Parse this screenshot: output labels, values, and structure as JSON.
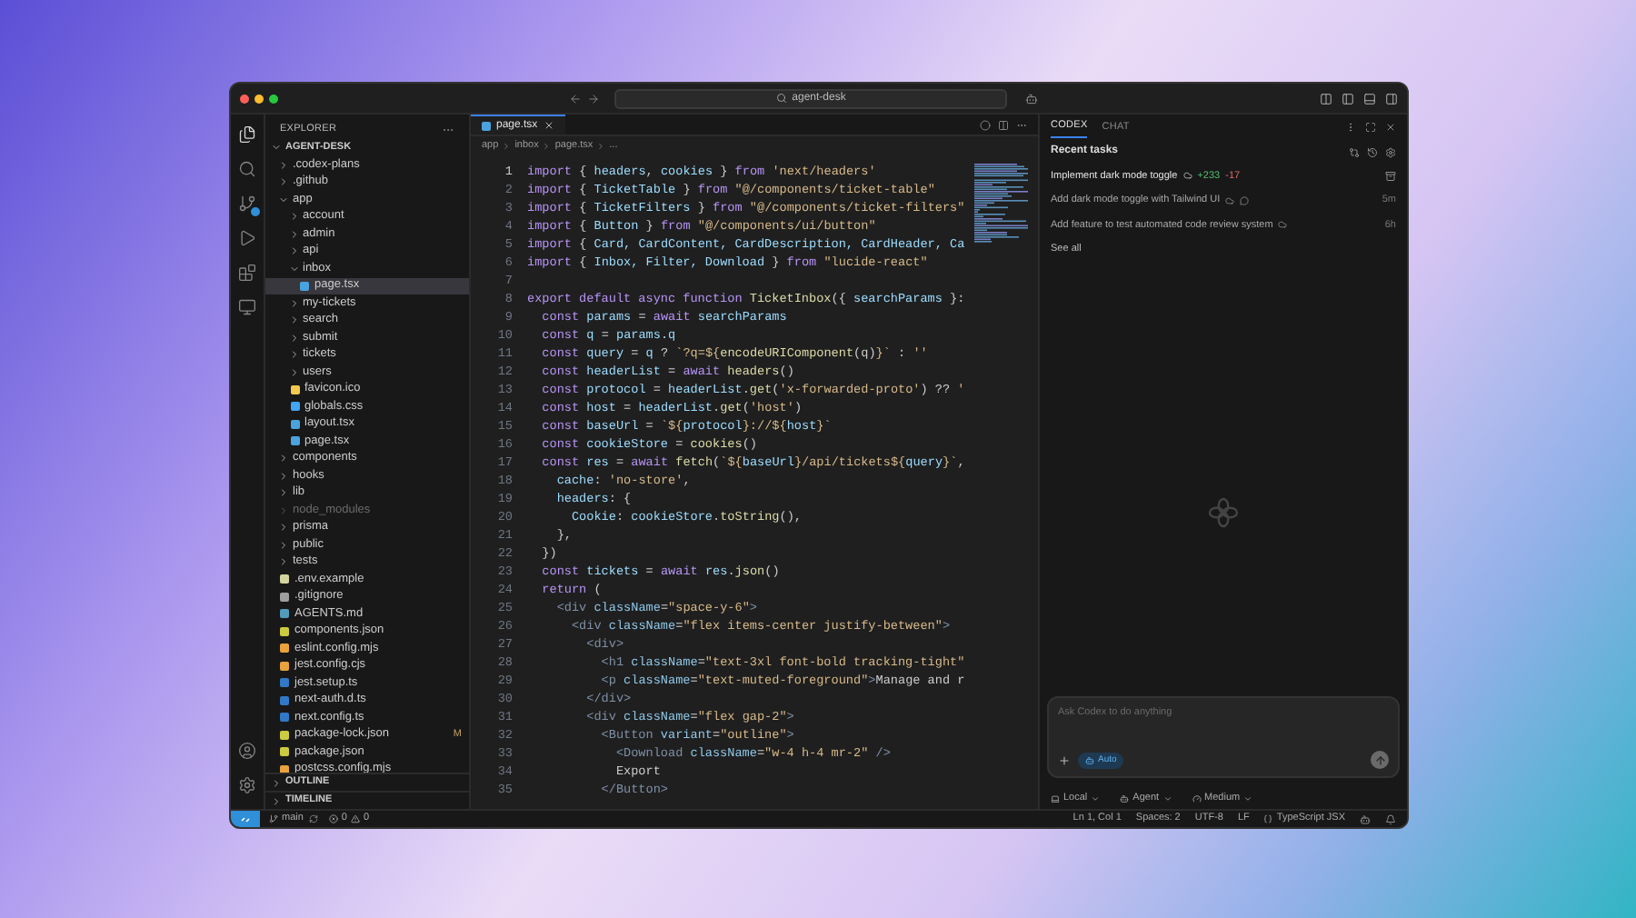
{
  "window": {
    "search": "agent-desk"
  },
  "sidebar": {
    "title": "EXPLORER",
    "root": "AGENT-DESK",
    "tree": [
      {
        "name": ".codex-plans",
        "kind": "folder",
        "expanded": false,
        "selected": false,
        "ignored": false
      },
      {
        "name": ".github",
        "kind": "folder",
        "expanded": false,
        "selected": false,
        "ignored": false
      },
      {
        "name": "app",
        "kind": "folder",
        "expanded": true,
        "selected": false,
        "ignored": false,
        "children": [
          {
            "name": "account",
            "kind": "folder",
            "expanded": false,
            "selected": false,
            "ignored": false
          },
          {
            "name": "admin",
            "kind": "folder",
            "expanded": false,
            "selected": false,
            "ignored": false
          },
          {
            "name": "api",
            "kind": "folder",
            "expanded": false,
            "selected": false,
            "ignored": false
          },
          {
            "name": "inbox",
            "kind": "folder",
            "expanded": true,
            "selected": false,
            "ignored": false,
            "children": [
              {
                "name": "page.tsx",
                "kind": "tsx",
                "selected": true,
                "ignored": false
              }
            ]
          },
          {
            "name": "my-tickets",
            "kind": "folder",
            "expanded": false,
            "selected": false,
            "ignored": false
          },
          {
            "name": "search",
            "kind": "folder",
            "expanded": false,
            "selected": false,
            "ignored": false
          },
          {
            "name": "submit",
            "kind": "folder",
            "expanded": false,
            "selected": false,
            "ignored": false
          },
          {
            "name": "tickets",
            "kind": "folder",
            "expanded": false,
            "selected": false,
            "ignored": false
          },
          {
            "name": "users",
            "kind": "folder",
            "expanded": false,
            "selected": false,
            "ignored": false
          },
          {
            "name": "favicon.ico",
            "kind": "ico",
            "selected": false,
            "ignored": false
          },
          {
            "name": "globals.css",
            "kind": "css",
            "selected": false,
            "ignored": false
          },
          {
            "name": "layout.tsx",
            "kind": "tsx",
            "selected": false,
            "ignored": false
          },
          {
            "name": "page.tsx",
            "kind": "tsx",
            "selected": false,
            "ignored": false
          }
        ]
      },
      {
        "name": "components",
        "kind": "folder",
        "expanded": false,
        "selected": false,
        "ignored": false
      },
      {
        "name": "hooks",
        "kind": "folder",
        "expanded": false,
        "selected": false,
        "ignored": false
      },
      {
        "name": "lib",
        "kind": "folder",
        "expanded": false,
        "selected": false,
        "ignored": false
      },
      {
        "name": "node_modules",
        "kind": "folder",
        "expanded": false,
        "selected": false,
        "ignored": true
      },
      {
        "name": "prisma",
        "kind": "folder",
        "expanded": false,
        "selected": false,
        "ignored": false
      },
      {
        "name": "public",
        "kind": "folder",
        "expanded": false,
        "selected": false,
        "ignored": false
      },
      {
        "name": "tests",
        "kind": "folder",
        "expanded": false,
        "selected": false,
        "ignored": false
      },
      {
        "name": ".env.example",
        "kind": "env",
        "selected": false,
        "ignored": false
      },
      {
        "name": ".gitignore",
        "kind": "git",
        "selected": false,
        "ignored": false
      },
      {
        "name": "AGENTS.md",
        "kind": "md",
        "selected": false,
        "ignored": false
      },
      {
        "name": "components.json",
        "kind": "json",
        "selected": false,
        "ignored": false
      },
      {
        "name": "eslint.config.mjs",
        "kind": "js",
        "selected": false,
        "ignored": false
      },
      {
        "name": "jest.config.cjs",
        "kind": "js",
        "selected": false,
        "ignored": false
      },
      {
        "name": "jest.setup.ts",
        "kind": "ts",
        "selected": false,
        "ignored": false
      },
      {
        "name": "next-auth.d.ts",
        "kind": "ts",
        "selected": false,
        "ignored": false
      },
      {
        "name": "next.config.ts",
        "kind": "ts",
        "selected": false,
        "ignored": false
      },
      {
        "name": "package-lock.json",
        "kind": "json",
        "selected": false,
        "ignored": false,
        "badge": "M"
      },
      {
        "name": "package.json",
        "kind": "json",
        "selected": false,
        "ignored": false
      },
      {
        "name": "postcss.config.mjs",
        "kind": "js",
        "selected": false,
        "ignored": false
      }
    ],
    "sections": [
      "OUTLINE",
      "TIMELINE"
    ]
  },
  "editor": {
    "tabs": [
      {
        "label": "page.tsx",
        "selected": true
      }
    ],
    "breadcrumb": [
      "app",
      "inbox",
      "page.tsx",
      "..."
    ],
    "lines": [
      {
        "number": "1",
        "tokens": [
          {
            "kind": "keyword",
            "text": "import"
          },
          {
            "kind": "plain",
            "text": " { "
          },
          {
            "kind": "variable",
            "text": "headers"
          },
          {
            "kind": "plain",
            "text": ", "
          },
          {
            "kind": "variable",
            "text": "cookies"
          },
          {
            "kind": "plain",
            "text": " } "
          },
          {
            "kind": "keyword",
            "text": "from"
          },
          {
            "kind": "string",
            "text": " 'next/headers'"
          }
        ]
      },
      {
        "number": "2",
        "tokens": [
          {
            "kind": "keyword",
            "text": "import"
          },
          {
            "kind": "plain",
            "text": " { "
          },
          {
            "kind": "variable",
            "text": "TicketTable"
          },
          {
            "kind": "plain",
            "text": " } "
          },
          {
            "kind": "keyword",
            "text": "from"
          },
          {
            "kind": "string",
            "text": " \"@/components/ticket-table\""
          }
        ]
      },
      {
        "number": "3",
        "tokens": [
          {
            "kind": "keyword",
            "text": "import"
          },
          {
            "kind": "plain",
            "text": " { "
          },
          {
            "kind": "variable",
            "text": "TicketFilters"
          },
          {
            "kind": "plain",
            "text": " } "
          },
          {
            "kind": "keyword",
            "text": "from"
          },
          {
            "kind": "string",
            "text": " \"@/components/ticket-filters\""
          }
        ]
      },
      {
        "number": "4",
        "tokens": [
          {
            "kind": "keyword",
            "text": "import"
          },
          {
            "kind": "plain",
            "text": " { "
          },
          {
            "kind": "variable",
            "text": "Button"
          },
          {
            "kind": "plain",
            "text": " } "
          },
          {
            "kind": "keyword",
            "text": "from"
          },
          {
            "kind": "string",
            "text": " \"@/components/ui/button\""
          }
        ]
      },
      {
        "number": "5",
        "tokens": [
          {
            "kind": "keyword",
            "text": "import"
          },
          {
            "kind": "plain",
            "text": " { "
          },
          {
            "kind": "variable",
            "text": "Card, CardContent, CardDescription, CardHeader, Ca"
          }
        ]
      },
      {
        "number": "6",
        "tokens": [
          {
            "kind": "keyword",
            "text": "import"
          },
          {
            "kind": "plain",
            "text": " { "
          },
          {
            "kind": "variable",
            "text": "Inbox, Filter, Download"
          },
          {
            "kind": "plain",
            "text": " } "
          },
          {
            "kind": "keyword",
            "text": "from"
          },
          {
            "kind": "string",
            "text": " \"lucide-react\""
          }
        ]
      },
      {
        "number": "7"
      },
      {
        "number": "8",
        "tokens": [
          {
            "kind": "keyword",
            "text": "export default async function "
          },
          {
            "kind": "function",
            "text": "TicketInbox"
          },
          {
            "kind": "plain",
            "text": "({ "
          },
          {
            "kind": "variable",
            "text": "searchParams"
          },
          {
            "kind": "plain",
            "text": " }:"
          }
        ]
      },
      {
        "number": "9",
        "tokens": [
          {
            "kind": "keyword",
            "text": "  const "
          },
          {
            "kind": "variable",
            "text": "params"
          },
          {
            "kind": "plain",
            "text": " = "
          },
          {
            "kind": "keyword",
            "text": "await "
          },
          {
            "kind": "variable",
            "text": "searchParams"
          }
        ]
      },
      {
        "number": "10",
        "tokens": [
          {
            "kind": "keyword",
            "text": "  const "
          },
          {
            "kind": "variable",
            "text": "q"
          },
          {
            "kind": "plain",
            "text": " = "
          },
          {
            "kind": "variable",
            "text": "params.q"
          }
        ]
      },
      {
        "number": "11",
        "tokens": [
          {
            "kind": "keyword",
            "text": "  const "
          },
          {
            "kind": "variable",
            "text": "query"
          },
          {
            "kind": "plain",
            "text": " = "
          },
          {
            "kind": "variable",
            "text": "q"
          },
          {
            "kind": "plain",
            "text": " ? "
          },
          {
            "kind": "string",
            "text": "`?q=${"
          },
          {
            "kind": "function",
            "text": "encodeURIComponent"
          },
          {
            "kind": "plain",
            "text": "(q)"
          },
          {
            "kind": "string",
            "text": "}`"
          },
          {
            "kind": "plain",
            "text": " : "
          },
          {
            "kind": "string",
            "text": "''"
          }
        ]
      },
      {
        "number": "12",
        "tokens": [
          {
            "kind": "keyword",
            "text": "  const "
          },
          {
            "kind": "variable",
            "text": "headerList"
          },
          {
            "kind": "plain",
            "text": " = "
          },
          {
            "kind": "keyword",
            "text": "await "
          },
          {
            "kind": "function",
            "text": "headers"
          },
          {
            "kind": "plain",
            "text": "()"
          }
        ]
      },
      {
        "number": "13",
        "tokens": [
          {
            "kind": "keyword",
            "text": "  const "
          },
          {
            "kind": "variable",
            "text": "protocol"
          },
          {
            "kind": "plain",
            "text": " = "
          },
          {
            "kind": "variable",
            "text": "headerList"
          },
          {
            "kind": "plain",
            "text": "."
          },
          {
            "kind": "function",
            "text": "get"
          },
          {
            "kind": "plain",
            "text": "("
          },
          {
            "kind": "string",
            "text": "'x-forwarded-proto'"
          },
          {
            "kind": "plain",
            "text": ") ?? "
          },
          {
            "kind": "string",
            "text": "'"
          }
        ]
      },
      {
        "number": "14",
        "tokens": [
          {
            "kind": "keyword",
            "text": "  const "
          },
          {
            "kind": "variable",
            "text": "host"
          },
          {
            "kind": "plain",
            "text": " = "
          },
          {
            "kind": "variable",
            "text": "headerList"
          },
          {
            "kind": "plain",
            "text": "."
          },
          {
            "kind": "function",
            "text": "get"
          },
          {
            "kind": "plain",
            "text": "("
          },
          {
            "kind": "string",
            "text": "'host'"
          },
          {
            "kind": "plain",
            "text": ")"
          }
        ]
      },
      {
        "number": "15",
        "tokens": [
          {
            "kind": "keyword",
            "text": "  const "
          },
          {
            "kind": "variable",
            "text": "baseUrl"
          },
          {
            "kind": "plain",
            "text": " = "
          },
          {
            "kind": "string",
            "text": "`${"
          },
          {
            "kind": "variable",
            "text": "protocol"
          },
          {
            "kind": "string",
            "text": "}://${"
          },
          {
            "kind": "variable",
            "text": "host"
          },
          {
            "kind": "string",
            "text": "}`"
          }
        ]
      },
      {
        "number": "16",
        "tokens": [
          {
            "kind": "keyword",
            "text": "  const "
          },
          {
            "kind": "variable",
            "text": "cookieStore"
          },
          {
            "kind": "plain",
            "text": " = "
          },
          {
            "kind": "function",
            "text": "cookies"
          },
          {
            "kind": "plain",
            "text": "()"
          }
        ]
      },
      {
        "number": "17",
        "tokens": [
          {
            "kind": "keyword",
            "text": "  const "
          },
          {
            "kind": "variable",
            "text": "res"
          },
          {
            "kind": "plain",
            "text": " = "
          },
          {
            "kind": "keyword",
            "text": "await "
          },
          {
            "kind": "function",
            "text": "fetch"
          },
          {
            "kind": "plain",
            "text": "("
          },
          {
            "kind": "string",
            "text": "`${"
          },
          {
            "kind": "variable",
            "text": "baseUrl"
          },
          {
            "kind": "string",
            "text": "}/api/tickets${"
          },
          {
            "kind": "variable",
            "text": "query"
          },
          {
            "kind": "string",
            "text": "}`"
          },
          {
            "kind": "plain",
            "text": ","
          }
        ]
      },
      {
        "number": "18",
        "tokens": [
          {
            "kind": "variable",
            "text": "    cache"
          },
          {
            "kind": "plain",
            "text": ": "
          },
          {
            "kind": "string",
            "text": "'no-store'"
          },
          {
            "kind": "plain",
            "text": ","
          }
        ]
      },
      {
        "number": "19",
        "tokens": [
          {
            "kind": "variable",
            "text": "    headers"
          },
          {
            "kind": "plain",
            "text": ": {"
          }
        ]
      },
      {
        "number": "20",
        "tokens": [
          {
            "kind": "variable",
            "text": "      Cookie"
          },
          {
            "kind": "plain",
            "text": ": "
          },
          {
            "kind": "variable",
            "text": "cookieStore"
          },
          {
            "kind": "plain",
            "text": "."
          },
          {
            "kind": "function",
            "text": "toString"
          },
          {
            "kind": "plain",
            "text": "(),"
          }
        ]
      },
      {
        "number": "21",
        "tokens": [
          {
            "kind": "plain",
            "text": "    },"
          }
        ]
      },
      {
        "number": "22",
        "tokens": [
          {
            "kind": "plain",
            "text": "  })"
          }
        ]
      },
      {
        "number": "23",
        "tokens": [
          {
            "kind": "keyword",
            "text": "  const "
          },
          {
            "kind": "variable",
            "text": "tickets"
          },
          {
            "kind": "plain",
            "text": " = "
          },
          {
            "kind": "keyword",
            "text": "await "
          },
          {
            "kind": "variable",
            "text": "res"
          },
          {
            "kind": "plain",
            "text": "."
          },
          {
            "kind": "function",
            "text": "json"
          },
          {
            "kind": "plain",
            "text": "()"
          }
        ]
      },
      {
        "number": "24",
        "tokens": [
          {
            "kind": "keyword",
            "text": "  return"
          },
          {
            "kind": "plain",
            "text": " ("
          }
        ]
      },
      {
        "number": "25",
        "tokens": [
          {
            "kind": "tag",
            "text": "    <div "
          },
          {
            "kind": "attribute",
            "text": "className"
          },
          {
            "kind": "plain",
            "text": "="
          },
          {
            "kind": "string",
            "text": "\"space-y-6\""
          },
          {
            "kind": "tag",
            "text": ">"
          }
        ]
      },
      {
        "number": "26",
        "tokens": [
          {
            "kind": "tag",
            "text": "      <div "
          },
          {
            "kind": "attribute",
            "text": "className"
          },
          {
            "kind": "plain",
            "text": "="
          },
          {
            "kind": "string",
            "text": "\"flex items-center justify-between\""
          },
          {
            "kind": "tag",
            "text": ">"
          }
        ]
      },
      {
        "number": "27",
        "tokens": [
          {
            "kind": "tag",
            "text": "        <div>"
          }
        ]
      },
      {
        "number": "28",
        "tokens": [
          {
            "kind": "tag",
            "text": "          <h1 "
          },
          {
            "kind": "attribute",
            "text": "className"
          },
          {
            "kind": "plain",
            "text": "="
          },
          {
            "kind": "string",
            "text": "\"text-3xl font-bold tracking-tight\""
          }
        ]
      },
      {
        "number": "29",
        "tokens": [
          {
            "kind": "tag",
            "text": "          <p "
          },
          {
            "kind": "attribute",
            "text": "className"
          },
          {
            "kind": "plain",
            "text": "="
          },
          {
            "kind": "string",
            "text": "\"text-muted-foreground\""
          },
          {
            "kind": "tag",
            "text": ">"
          },
          {
            "kind": "plain",
            "text": "Manage and r"
          }
        ]
      },
      {
        "number": "30",
        "tokens": [
          {
            "kind": "tag",
            "text": "        </div>"
          }
        ]
      },
      {
        "number": "31",
        "tokens": [
          {
            "kind": "tag",
            "text": "        <div "
          },
          {
            "kind": "attribute",
            "text": "className"
          },
          {
            "kind": "plain",
            "text": "="
          },
          {
            "kind": "string",
            "text": "\"flex gap-2\""
          },
          {
            "kind": "tag",
            "text": ">"
          }
        ]
      },
      {
        "number": "32",
        "tokens": [
          {
            "kind": "tag",
            "text": "          <Button "
          },
          {
            "kind": "attribute",
            "text": "variant"
          },
          {
            "kind": "plain",
            "text": "="
          },
          {
            "kind": "string",
            "text": "\"outline\""
          },
          {
            "kind": "tag",
            "text": ">"
          }
        ]
      },
      {
        "number": "33",
        "tokens": [
          {
            "kind": "tag",
            "text": "            <Download "
          },
          {
            "kind": "attribute",
            "text": "className"
          },
          {
            "kind": "plain",
            "text": "="
          },
          {
            "kind": "string",
            "text": "\"w-4 h-4 mr-2\""
          },
          {
            "kind": "tag",
            "text": " />"
          }
        ]
      },
      {
        "number": "34",
        "tokens": [
          {
            "kind": "plain",
            "text": "            Export"
          }
        ]
      },
      {
        "number": "35",
        "tokens": [
          {
            "kind": "tag",
            "text": "          </Button>"
          }
        ]
      }
    ]
  },
  "codex": {
    "tabs": [
      {
        "label": "CODEX",
        "selected": true
      },
      {
        "label": "CHAT",
        "selected": false
      }
    ],
    "heading": "Recent tasks",
    "tasks": [
      {
        "title": "Implement dark mode toggle",
        "added": "+233",
        "removed": "-17",
        "hovered": true,
        "commented": false
      },
      {
        "title": "Add dark mode toggle with Tailwind UI",
        "time": "5m",
        "hovered": false,
        "commented": true
      },
      {
        "title": "Add feature to test automated code review system",
        "time": "6h",
        "hovered": false,
        "commented": false
      }
    ],
    "see_all": "See all",
    "composer": {
      "placeholder": "Ask Codex to do anything",
      "mode": "Auto"
    },
    "options": [
      "Local",
      "Agent",
      "Medium"
    ]
  },
  "status_bar": {
    "branch": "main",
    "errors": "0",
    "warnings": "0",
    "items": [
      "Ln 1, Col 1",
      "Spaces: 2",
      "UTF-8",
      "LF"
    ],
    "language": "TypeScript JSX"
  }
}
